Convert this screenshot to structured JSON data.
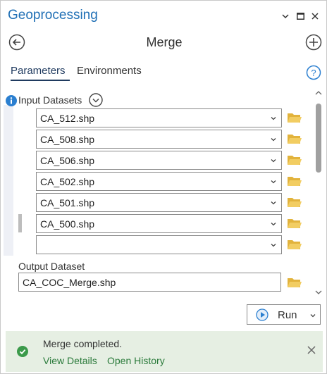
{
  "window": {
    "title": "Geoprocessing",
    "controls": {
      "menu": "chevron-down-icon",
      "maximize": "maximize-icon",
      "close": "close-icon"
    }
  },
  "tool": {
    "title": "Merge",
    "back_icon": "back-arrow-icon",
    "add_icon": "add-icon"
  },
  "tabs": [
    {
      "label": "Parameters",
      "active": true
    },
    {
      "label": "Environments",
      "active": false
    }
  ],
  "help_icon": "help-icon",
  "parameters": {
    "input_datasets": {
      "label": "Input Datasets",
      "items": [
        "CA_512.shp",
        "CA_508.shp",
        "CA_506.shp",
        "CA_502.shp",
        "CA_501.shp",
        "CA_500.shp",
        ""
      ]
    },
    "output_dataset": {
      "label": "Output Dataset",
      "value": "CA_COC_Merge.shp"
    }
  },
  "run": {
    "label": "Run"
  },
  "status": {
    "message": "Merge completed.",
    "links": [
      "View Details",
      "Open History"
    ],
    "color": "#2a7a3a"
  },
  "colors": {
    "accent": "#1f6fb5",
    "folder": "#e2b33c",
    "status_bg": "#e6efe3"
  }
}
